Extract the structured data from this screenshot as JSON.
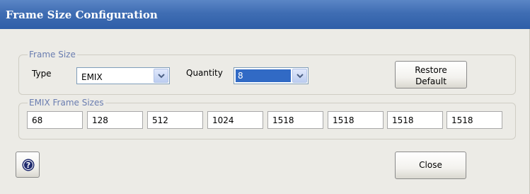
{
  "window": {
    "title": "Frame Size Configuration"
  },
  "frame_size_group": {
    "label": "Frame Size",
    "type_label": "Type",
    "type_value": "EMIX",
    "quantity_label": "Quantity",
    "quantity_value": "8",
    "restore_label_line1": "Restore",
    "restore_label_line2": "Default"
  },
  "emix_group": {
    "label": "EMIX Frame Sizes",
    "sizes": [
      "68",
      "128",
      "512",
      "1024",
      "1518",
      "1518",
      "1518",
      "1518"
    ]
  },
  "footer": {
    "help_icon": "question-circle-icon",
    "close_label": "Close"
  },
  "colors": {
    "titlebar": "#3f6db3",
    "selection": "#316ac5",
    "group_label": "#6a7db0"
  }
}
